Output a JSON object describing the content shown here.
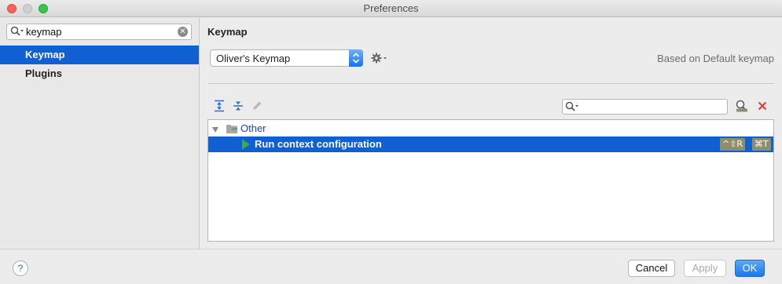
{
  "window": {
    "title": "Preferences"
  },
  "sidebar": {
    "search_value": "keymap",
    "items": [
      {
        "label": "Keymap",
        "selected": true
      },
      {
        "label": "Plugins",
        "selected": false
      }
    ]
  },
  "main": {
    "title": "Keymap",
    "keymap_select": {
      "value": "Oliver's Keymap"
    },
    "based_on": "Based on Default keymap",
    "filter": {
      "value": ""
    },
    "tree": {
      "group": {
        "label": "Other",
        "expanded": true
      },
      "action": {
        "label": "Run context configuration",
        "shortcuts": [
          "^⇧R",
          "⌘T"
        ],
        "selected": true
      }
    }
  },
  "footer": {
    "help": "?",
    "cancel": "Cancel",
    "apply": "Apply",
    "ok": "OK"
  },
  "colors": {
    "selection": "#1160d3",
    "group_text": "#1a3fd6",
    "ok_button": "#1a77f0"
  },
  "icons": {
    "search": "search-icon",
    "clear": "clear-icon",
    "gear": "gear-icon",
    "expand_all": "expand-all-icon",
    "collapse_all": "collapse-all-icon",
    "edit": "pencil-icon",
    "find_by_shortcut": "find-shortcut-icon",
    "clear_filter": "close-icon",
    "folder": "folder-icon",
    "run": "play-icon"
  }
}
